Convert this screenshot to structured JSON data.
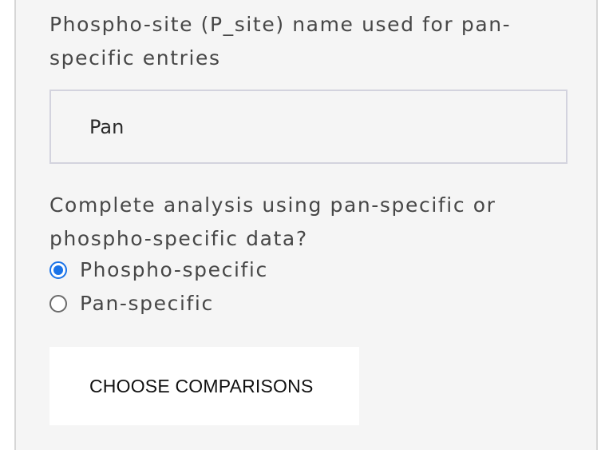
{
  "phospho_site": {
    "label": "Phospho-site (P_site) name used for pan-specific entries",
    "input_value": "Pan"
  },
  "analysis_mode": {
    "question": "Complete analysis using pan-specific or phospho-specific data?",
    "options": [
      {
        "label": "Phospho-specific",
        "selected": true
      },
      {
        "label": "Pan-specific",
        "selected": false
      }
    ]
  },
  "actions": {
    "choose_comparisons_label": "CHOOSE COMPARISONS"
  },
  "colors": {
    "accent": "#1a73e8",
    "panel_background": "#f5f5f5"
  }
}
